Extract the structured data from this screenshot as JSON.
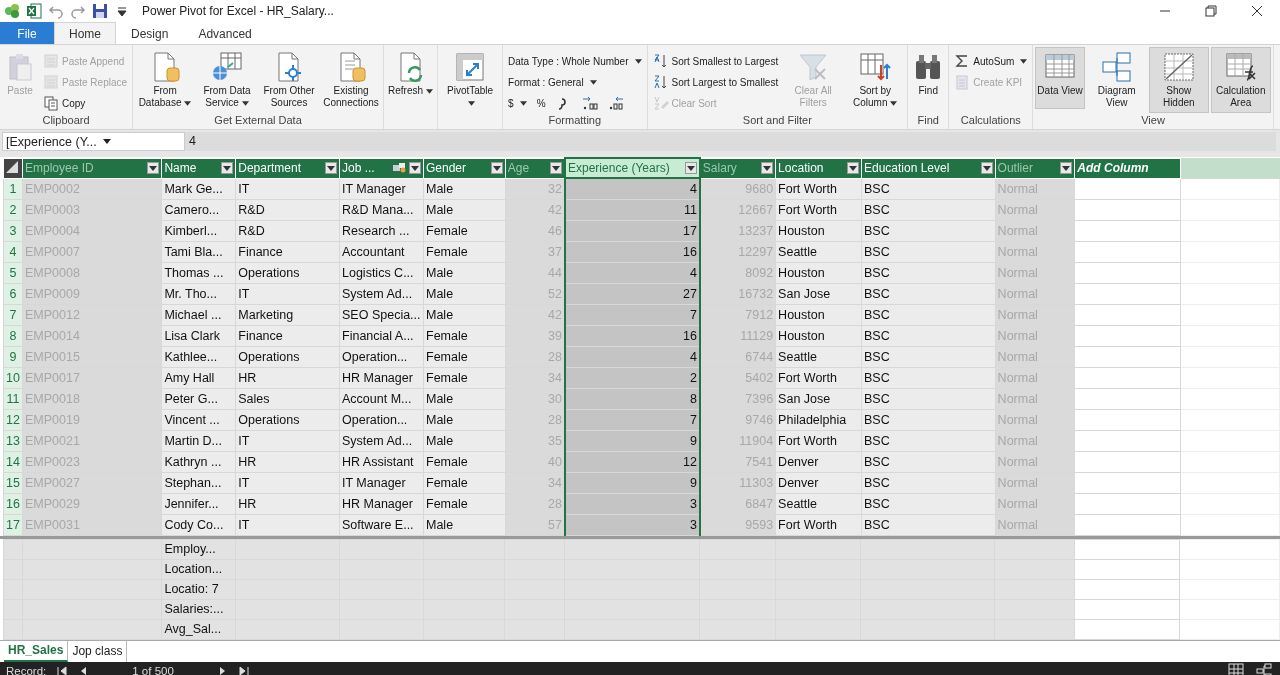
{
  "window": {
    "title": "Power Pivot for Excel - HR_Salary..."
  },
  "tabs": [
    {
      "label": "File",
      "kind": "file",
      "selected": false
    },
    {
      "label": "Home",
      "kind": "tab",
      "selected": true
    },
    {
      "label": "Design",
      "kind": "tab",
      "selected": false
    },
    {
      "label": "Advanced",
      "kind": "tab",
      "selected": false
    }
  ],
  "ribbon": {
    "groups": [
      {
        "label": "Clipboard",
        "items": [
          {
            "kind": "large",
            "label": "Paste",
            "disabled": true,
            "pressed": false,
            "dropdown": false
          },
          {
            "kind": "small",
            "label": "Paste Append",
            "disabled": true,
            "pressed": false,
            "dropdown": false
          },
          {
            "kind": "small",
            "label": "Paste Replace",
            "disabled": true,
            "pressed": false,
            "dropdown": false
          },
          {
            "kind": "small",
            "label": "Copy",
            "disabled": false,
            "pressed": false,
            "dropdown": false
          }
        ]
      },
      {
        "label": "Get External Data",
        "items": [
          {
            "kind": "large",
            "label": "From Database",
            "disabled": false,
            "pressed": false,
            "dropdown": true
          },
          {
            "kind": "large",
            "label": "From Data Service",
            "disabled": false,
            "pressed": false,
            "dropdown": true
          },
          {
            "kind": "large",
            "label": "From Other Sources",
            "disabled": false,
            "pressed": false,
            "dropdown": false
          },
          {
            "kind": "large",
            "label": "Existing Connections",
            "disabled": false,
            "pressed": false,
            "dropdown": false
          }
        ]
      },
      {
        "items": [
          {
            "kind": "large",
            "label": "Refresh",
            "disabled": false,
            "pressed": false,
            "dropdown": true
          }
        ]
      },
      {
        "items": [
          {
            "kind": "large",
            "label": "PivotTable",
            "disabled": false,
            "pressed": false,
            "dropdown": true
          }
        ]
      },
      {
        "label": "Formatting",
        "items": [
          {
            "kind": "menu",
            "label": "Data Type : Whole Number",
            "disabled": false,
            "pressed": false,
            "dropdown": true
          },
          {
            "kind": "menu",
            "label": "Format : General",
            "disabled": false,
            "pressed": false,
            "dropdown": true
          },
          {
            "kind": "symbol",
            "label": "$",
            "disabled": false,
            "pressed": false,
            "dropdown": true
          },
          {
            "kind": "symbol",
            "label": "%",
            "disabled": false,
            "pressed": false,
            "dropdown": false
          },
          {
            "kind": "icon",
            "disabled": false,
            "pressed": false,
            "dropdown": false
          },
          {
            "kind": "icon",
            "disabled": false,
            "pressed": false,
            "dropdown": false
          },
          {
            "kind": "icon",
            "disabled": false,
            "pressed": false,
            "dropdown": false
          }
        ]
      },
      {
        "label": "Sort and Filter",
        "items": [
          {
            "kind": "small",
            "label": "Sort Smallest to Largest",
            "disabled": false,
            "pressed": false,
            "dropdown": false
          },
          {
            "kind": "small",
            "label": "Sort Largest to Smallest",
            "disabled": false,
            "pressed": false,
            "dropdown": false
          },
          {
            "kind": "small",
            "label": "Clear Sort",
            "disabled": true,
            "pressed": false,
            "dropdown": false
          },
          {
            "kind": "large",
            "label": "Clear All Filters",
            "disabled": true,
            "pressed": false,
            "dropdown": false
          },
          {
            "kind": "large",
            "label": "Sort by Column",
            "disabled": false,
            "pressed": false,
            "dropdown": true
          }
        ]
      },
      {
        "label": "Find",
        "items": [
          {
            "kind": "large",
            "label": "Find",
            "disabled": false,
            "pressed": false,
            "dropdown": false
          }
        ]
      },
      {
        "label": "Calculations",
        "items": [
          {
            "kind": "small",
            "label": "AutoSum",
            "disabled": false,
            "pressed": false,
            "dropdown": true
          },
          {
            "kind": "small",
            "label": "Create KPI",
            "disabled": true,
            "pressed": false,
            "dropdown": false
          }
        ]
      },
      {
        "label": "View",
        "items": [
          {
            "kind": "large",
            "label": "Data View",
            "disabled": false,
            "pressed": true,
            "dropdown": false
          },
          {
            "kind": "large",
            "label": "Diagram View",
            "disabled": false,
            "pressed": false,
            "dropdown": false
          },
          {
            "kind": "large",
            "label": "Show Hidden",
            "disabled": false,
            "pressed": true,
            "dropdown": false
          },
          {
            "kind": "large",
            "label": "Calculation Area",
            "disabled": false,
            "pressed": true,
            "dropdown": false
          }
        ]
      }
    ]
  },
  "formula_bar": {
    "name_box": "[Experience (Y...",
    "value": "4"
  },
  "table": {
    "columns": [
      {
        "label": "Employee ID",
        "kind": "text",
        "hidden": true,
        "selected": false,
        "linked": false
      },
      {
        "label": "Name",
        "kind": "text",
        "hidden": false,
        "selected": false,
        "linked": false
      },
      {
        "label": "Department",
        "kind": "text",
        "hidden": false,
        "selected": false,
        "linked": false
      },
      {
        "label": "Job ...",
        "kind": "text",
        "hidden": false,
        "selected": false,
        "linked": true
      },
      {
        "label": "Gender",
        "kind": "text",
        "hidden": false,
        "selected": false,
        "linked": false
      },
      {
        "label": "Age",
        "kind": "number",
        "hidden": true,
        "selected": false,
        "linked": false
      },
      {
        "label": "Experience (Years)",
        "kind": "number",
        "hidden": false,
        "selected": true,
        "linked": false
      },
      {
        "label": "Salary",
        "kind": "number",
        "hidden": true,
        "selected": false,
        "linked": false
      },
      {
        "label": "Location",
        "kind": "text",
        "hidden": false,
        "selected": false,
        "linked": false
      },
      {
        "label": "Education Level",
        "kind": "text",
        "hidden": false,
        "selected": false,
        "linked": false
      },
      {
        "label": "Outlier",
        "kind": "text",
        "hidden": true,
        "selected": false,
        "linked": false
      },
      {
        "label": "Add Column",
        "kind": "add",
        "hidden": false,
        "selected": false,
        "linked": false
      }
    ],
    "rows": [
      {
        "number": "1",
        "cells": [
          "EMP0002",
          "Mark Ge...",
          "IT",
          "IT Manager",
          "Male",
          "32",
          "4",
          "9680",
          "Fort Worth",
          "BSC",
          "Normal"
        ]
      },
      {
        "number": "2",
        "cells": [
          "EMP0003",
          "Camero...",
          "R&D",
          "R&D Mana...",
          "Male",
          "42",
          "11",
          "12667",
          "Fort Worth",
          "BSC",
          "Normal"
        ]
      },
      {
        "number": "3",
        "cells": [
          "EMP0004",
          "Kimberl...",
          "R&D",
          "Research ...",
          "Female",
          "46",
          "17",
          "13237",
          "Houston",
          "BSC",
          "Normal"
        ]
      },
      {
        "number": "4",
        "cells": [
          "EMP0007",
          "Tami Bla...",
          "Finance",
          "Accountant",
          "Female",
          "37",
          "16",
          "12297",
          "Seattle",
          "BSC",
          "Normal"
        ]
      },
      {
        "number": "5",
        "cells": [
          "EMP0008",
          "Thomas ...",
          "Operations",
          "Logistics C...",
          "Male",
          "44",
          "4",
          "8092",
          "Houston",
          "BSC",
          "Normal"
        ]
      },
      {
        "number": "6",
        "cells": [
          "EMP0009",
          "Mr. Tho...",
          "IT",
          "System Ad...",
          "Male",
          "52",
          "27",
          "16732",
          "San Jose",
          "BSC",
          "Normal"
        ]
      },
      {
        "number": "7",
        "cells": [
          "EMP0012",
          "Michael ...",
          "Marketing",
          "SEO Specia...",
          "Male",
          "42",
          "7",
          "7912",
          "Houston",
          "BSC",
          "Normal"
        ]
      },
      {
        "number": "8",
        "cells": [
          "EMP0014",
          "Lisa Clark",
          "Finance",
          "Financial A...",
          "Female",
          "39",
          "16",
          "11129",
          "Houston",
          "BSC",
          "Normal"
        ]
      },
      {
        "number": "9",
        "cells": [
          "EMP0015",
          "Kathlee...",
          "Operations",
          "Operation...",
          "Female",
          "28",
          "4",
          "6744",
          "Seattle",
          "BSC",
          "Normal"
        ]
      },
      {
        "number": "10",
        "cells": [
          "EMP0017",
          "Amy Hall",
          "HR",
          "HR Manager",
          "Female",
          "34",
          "2",
          "5402",
          "Fort Worth",
          "BSC",
          "Normal"
        ]
      },
      {
        "number": "11",
        "cells": [
          "EMP0018",
          "Peter G...",
          "Sales",
          "Account M...",
          "Male",
          "30",
          "8",
          "7396",
          "San Jose",
          "BSC",
          "Normal"
        ]
      },
      {
        "number": "12",
        "cells": [
          "EMP0019",
          "Vincent ...",
          "Operations",
          "Operation...",
          "Male",
          "28",
          "7",
          "9746",
          "Philadelphia",
          "BSC",
          "Normal"
        ]
      },
      {
        "number": "13",
        "cells": [
          "EMP0021",
          "Martin D...",
          "IT",
          "System Ad...",
          "Male",
          "35",
          "9",
          "11904",
          "Fort Worth",
          "BSC",
          "Normal"
        ]
      },
      {
        "number": "14",
        "cells": [
          "EMP0023",
          "Kathryn ...",
          "HR",
          "HR Assistant",
          "Female",
          "40",
          "12",
          "7541",
          "Denver",
          "BSC",
          "Normal"
        ]
      },
      {
        "number": "15",
        "cells": [
          "EMP0027",
          "Stephan...",
          "IT",
          "IT Manager",
          "Female",
          "34",
          "9",
          "11303",
          "Denver",
          "BSC",
          "Normal"
        ]
      },
      {
        "number": "16",
        "cells": [
          "EMP0029",
          "Jennifer...",
          "HR",
          "HR Manager",
          "Female",
          "28",
          "3",
          "6847",
          "Seattle",
          "BSC",
          "Normal"
        ]
      },
      {
        "number": "17",
        "cells": [
          "EMP0031",
          "Cody Co...",
          "IT",
          "Software E...",
          "Male",
          "57",
          "3",
          "9593",
          "Fort Worth",
          "BSC",
          "Normal"
        ]
      }
    ]
  },
  "calculation_area": {
    "measures": [
      "Employ...",
      "Location...",
      "Locatio: 7",
      "Salaries:...",
      "Avg_Sal..."
    ]
  },
  "sheet_tabs": [
    {
      "label": "HR_Sales",
      "selected": true
    },
    {
      "label": "Jop class",
      "selected": false
    }
  ],
  "status_bar": {
    "label": "Record:",
    "position": "1 of 500"
  }
}
